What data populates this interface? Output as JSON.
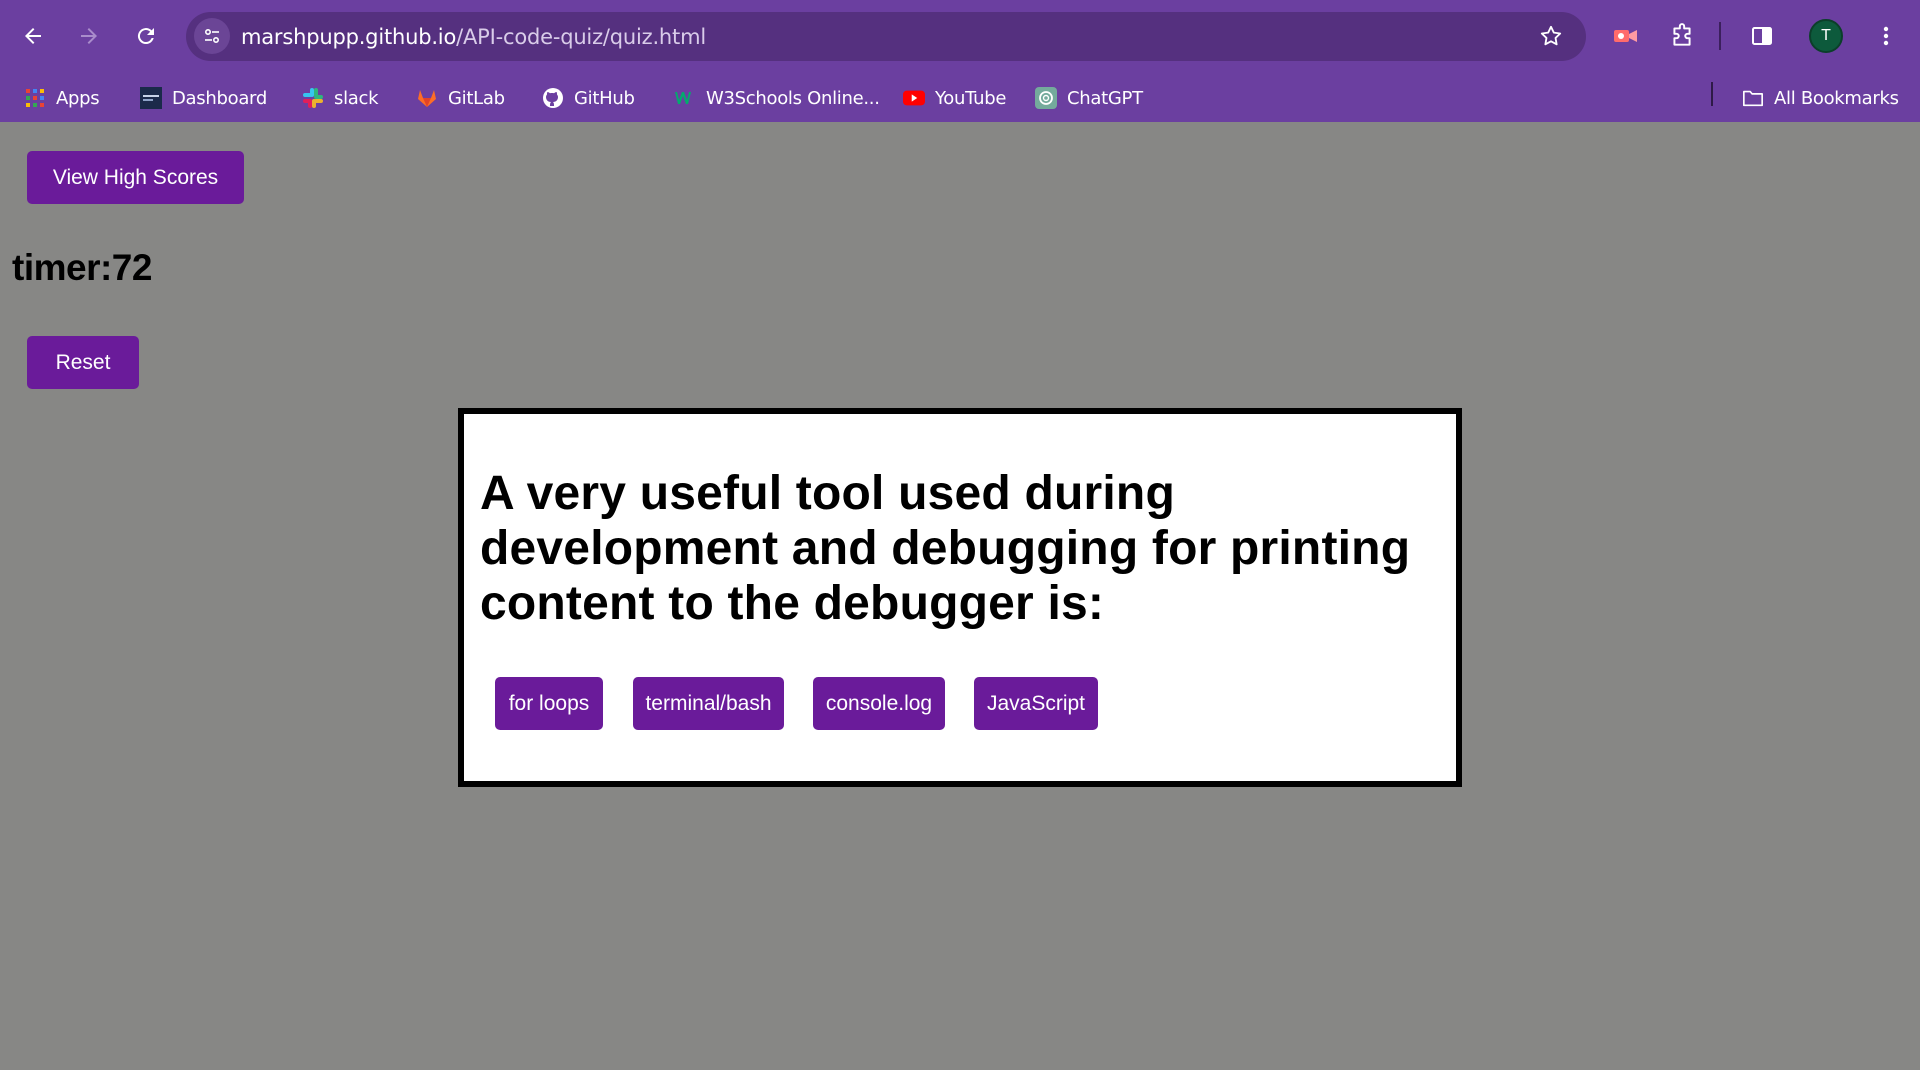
{
  "browser": {
    "url_host": "marshpupp.github.io",
    "url_path": "/API-code-quiz/quiz.html",
    "profile_initial": "T",
    "bookmarks": [
      {
        "label": "Apps",
        "icon": "apps-grid-icon"
      },
      {
        "label": "Dashboard",
        "icon": "dashboard-favicon"
      },
      {
        "label": "slack",
        "icon": "slack-icon"
      },
      {
        "label": "GitLab",
        "icon": "gitlab-icon"
      },
      {
        "label": "GitHub",
        "icon": "github-icon"
      },
      {
        "label": "W3Schools Online...",
        "icon": "w3schools-icon"
      },
      {
        "label": "YouTube",
        "icon": "youtube-icon"
      },
      {
        "label": "ChatGPT",
        "icon": "chatgpt-icon"
      }
    ],
    "all_bookmarks_label": "All Bookmarks",
    "colors": {
      "chrome": "#6b3fa0",
      "omnibox": "#55307f"
    }
  },
  "page": {
    "high_scores_label": "View High Scores",
    "timer_text": "timer:72",
    "reset_label": "Reset",
    "question": "A very useful tool used during development and debugging for printing content to the debugger is:",
    "answers": [
      "for loops",
      "terminal/bash",
      "console.log",
      "JavaScript"
    ],
    "colors": {
      "button": "#6a1b9a",
      "background": "#878785"
    }
  }
}
